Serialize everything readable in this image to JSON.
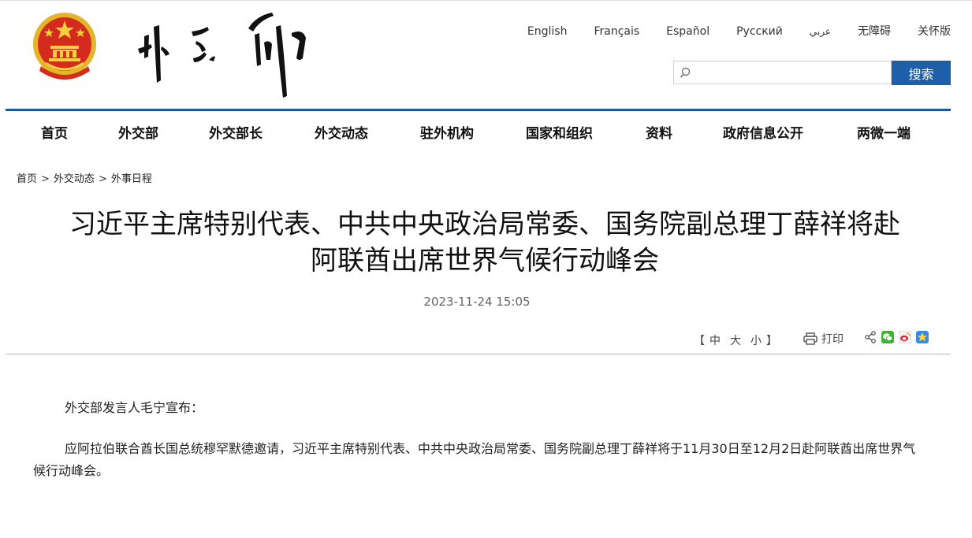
{
  "header": {
    "calligraphy_logo_text": "外交部",
    "languages": [
      "English",
      "Français",
      "Español",
      "Русский",
      "عربي",
      "无障碍",
      "关怀版"
    ],
    "search": {
      "placeholder": "",
      "button_label": "搜索"
    }
  },
  "nav": {
    "items": [
      "首页",
      "外交部",
      "外交部长",
      "外交动态",
      "驻外机构",
      "国家和组织",
      "资料",
      "政府信息公开",
      "两微一端"
    ]
  },
  "breadcrumb": {
    "items": [
      "首页",
      "外交动态",
      "外事日程"
    ],
    "separator": ">"
  },
  "article": {
    "title_line1": "习近平主席特别代表、中共中央政治局常委、国务院副总理丁薛祥将赴",
    "title_line2": "阿联酋出席世界气候行动峰会",
    "date": "2023-11-24 15:05",
    "paragraphs": [
      "外交部发言人毛宁宣布：",
      "应阿拉伯联合酋长国总统穆罕默德邀请，习近平主席特别代表、中共中央政治局常委、国务院副总理丁薛祥将于11月30日至12月2日赴阿联酋出席世界气候行动峰会。"
    ]
  },
  "tools": {
    "bracket_open": "【",
    "bracket_close": "】",
    "font_sizes": [
      "中",
      "大",
      "小"
    ],
    "print_label": "打印",
    "share_icons": [
      "share-icon",
      "wechat-icon",
      "weibo-icon",
      "qzone-icon"
    ]
  },
  "colors": {
    "accent_blue": "#1d5fa8",
    "nav_rule": "#1a5aa0",
    "divider": "#8dc6e6",
    "emblem_red": "#d52b1e",
    "emblem_gold": "#f4c430"
  }
}
